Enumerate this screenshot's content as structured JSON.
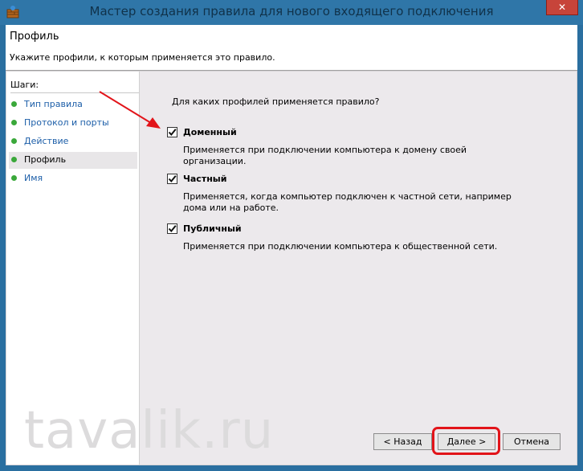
{
  "window": {
    "title": "Мастер создания правила для нового входящего подключения",
    "close_glyph": "✕"
  },
  "header": {
    "title": "Профиль",
    "description": "Укажите профили, к которым применяется это правило."
  },
  "steps": {
    "heading": "Шаги:",
    "items": [
      {
        "label": "Тип правила"
      },
      {
        "label": "Протокол и порты"
      },
      {
        "label": "Действие"
      },
      {
        "label": "Профиль"
      },
      {
        "label": "Имя"
      }
    ]
  },
  "main": {
    "question": "Для каких профилей применяется правило?",
    "options": [
      {
        "label": "Доменный",
        "checked": true,
        "description": "Применяется при подключении компьютера к домену своей организации."
      },
      {
        "label": "Частный",
        "checked": true,
        "description": "Применяется, когда компьютер подключен к частной сети, например дома или на работе."
      },
      {
        "label": "Публичный",
        "checked": true,
        "description": "Применяется при подключении компьютера к общественной сети."
      }
    ]
  },
  "buttons": {
    "back": "< Назад",
    "next": "Далее >",
    "cancel": "Отмена"
  },
  "watermark": "tavalik.ru",
  "colors": {
    "titlebar": "#2f76a8",
    "step_link": "#1c5ea8",
    "step_dot": "#3aa83a",
    "annotation": "#e2141a"
  }
}
